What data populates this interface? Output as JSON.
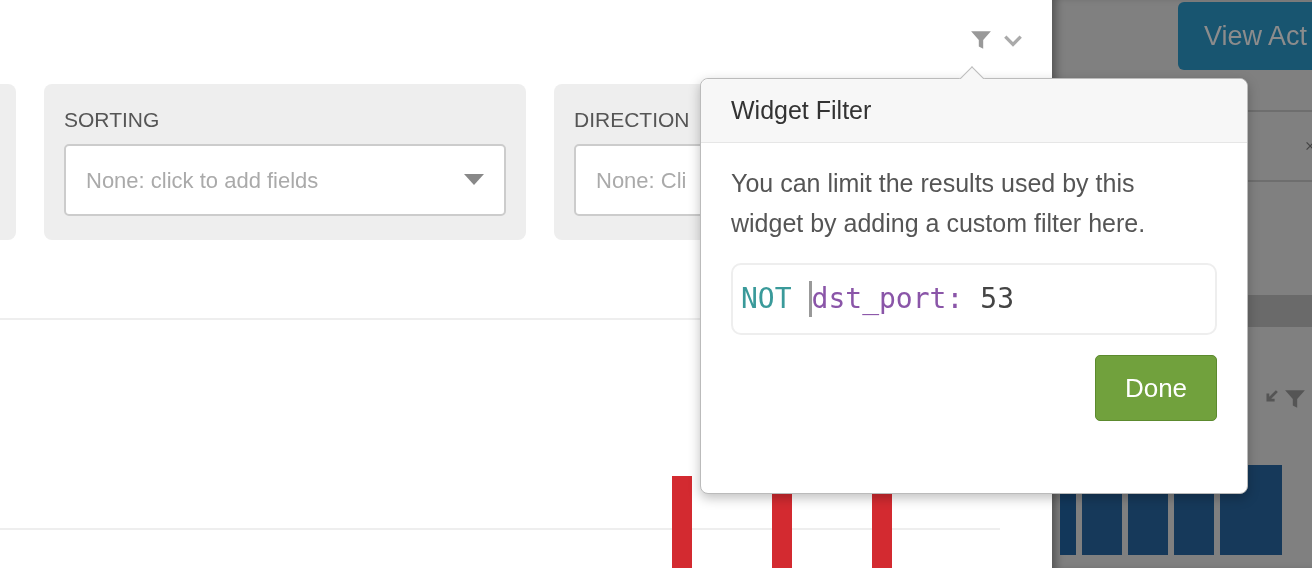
{
  "cards": [
    {
      "label": "SORTING",
      "placeholder": "None: click to add fields"
    },
    {
      "label": "DIRECTION",
      "placeholder": "None: Cli"
    }
  ],
  "popover": {
    "title": "Widget Filter",
    "description": "You can limit the results used by this widget by adding a custom filter here.",
    "query": [
      {
        "text": "NOT",
        "kind": "keyword"
      },
      {
        "text": "dst_port:",
        "kind": "field"
      },
      {
        "text": "53",
        "kind": "value"
      }
    ],
    "button": "Done"
  },
  "side_panel": {
    "button": "View Act"
  }
}
